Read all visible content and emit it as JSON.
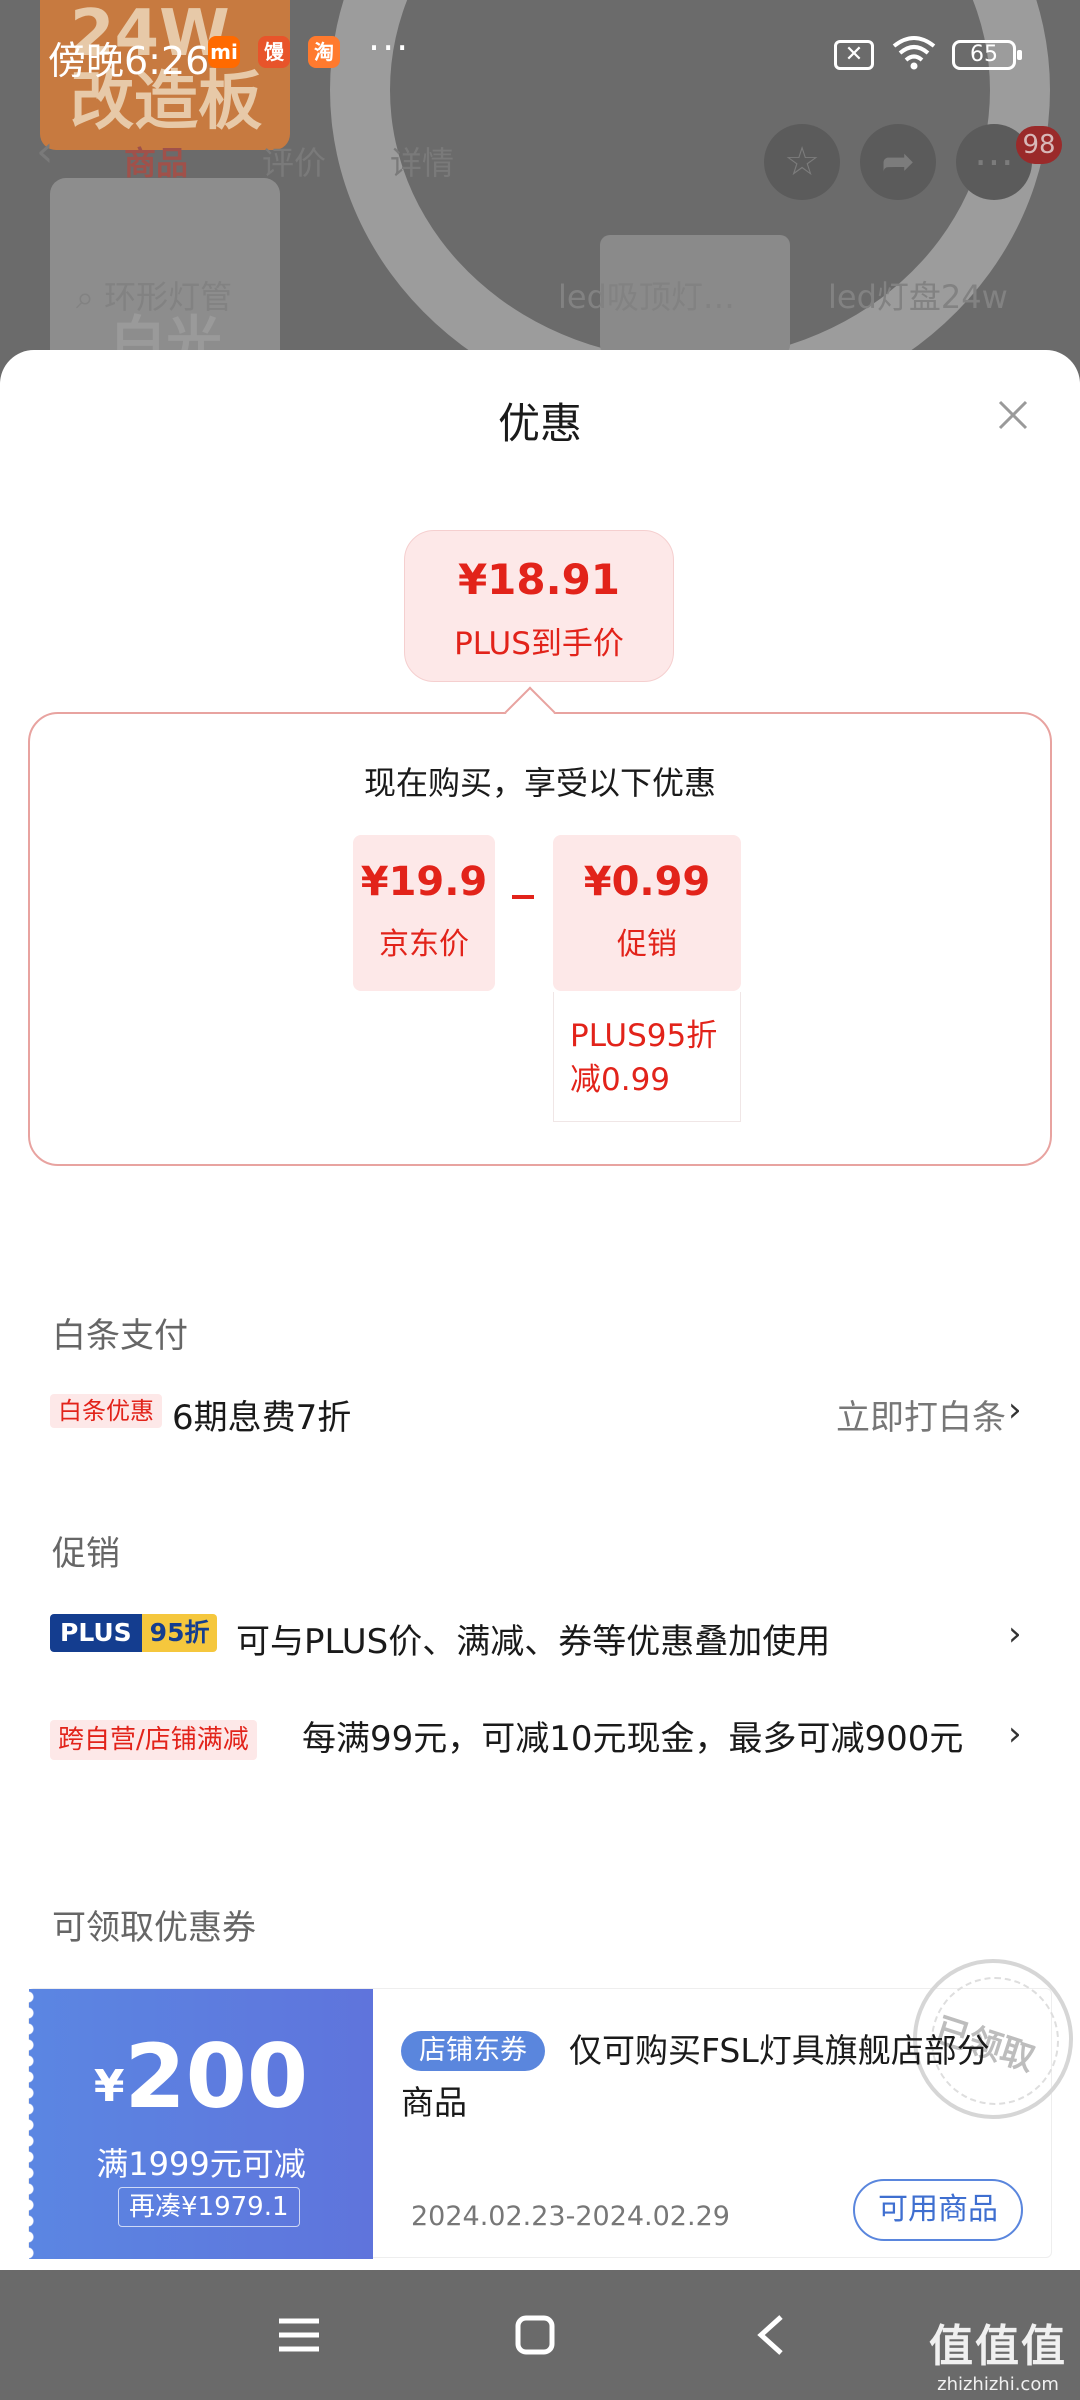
{
  "status_bar": {
    "time": "傍晚6:26",
    "app_icons": [
      "mi",
      "馒",
      "淘"
    ],
    "more": "···",
    "battery": "65"
  },
  "background": {
    "promo_text_1": "24W",
    "promo_text_2": "改造板",
    "promo_text_3": "白光",
    "tabs": [
      "商品",
      "评价",
      "详情"
    ],
    "search": [
      "环形灯管",
      "led吸顶灯…",
      "led灯盘24w"
    ],
    "cart_badge": "98"
  },
  "sheet": {
    "title": "优惠",
    "final_price": "¥18.91",
    "final_price_label": "PLUS到手价",
    "discount_heading": "现在购买，享受以下优惠",
    "jd_price": "¥19.9",
    "jd_price_label": "京东价",
    "promo_amount": "¥0.99",
    "promo_label": "促销",
    "promo_detail": "PLUS95折减0.99"
  },
  "baitiao": {
    "section": "白条支付",
    "tag": "白条优惠",
    "text": "6期息费7折",
    "action": "立即打白条"
  },
  "promotion": {
    "section": "促销",
    "plus_tag_1": "PLUS",
    "plus_tag_2": "95折",
    "plus_text": "可与PLUS价、满减、券等优惠叠加使用",
    "store_tag": "跨自营/店铺满减",
    "store_text": "每满99元，可减10元现金，最多可减900元"
  },
  "coupons": {
    "section": "可领取优惠券",
    "currency": "¥",
    "amount": "200",
    "condition": "满1999元可减",
    "more": "再凑¥1979.1",
    "type_tag": "店铺东券",
    "desc": "仅可购买FSL灯具旗舰店部分商品",
    "date": "2024.02.23-2024.02.29",
    "use_button": "可用商品",
    "stamp": "已领取"
  },
  "watermark": {
    "main": "值值值",
    "url": "zhizhizhi.com"
  },
  "colors": {
    "accent_red": "#e2231a",
    "pink_bg": "#fde8e8",
    "coupon_blue": "#5b86e2"
  }
}
